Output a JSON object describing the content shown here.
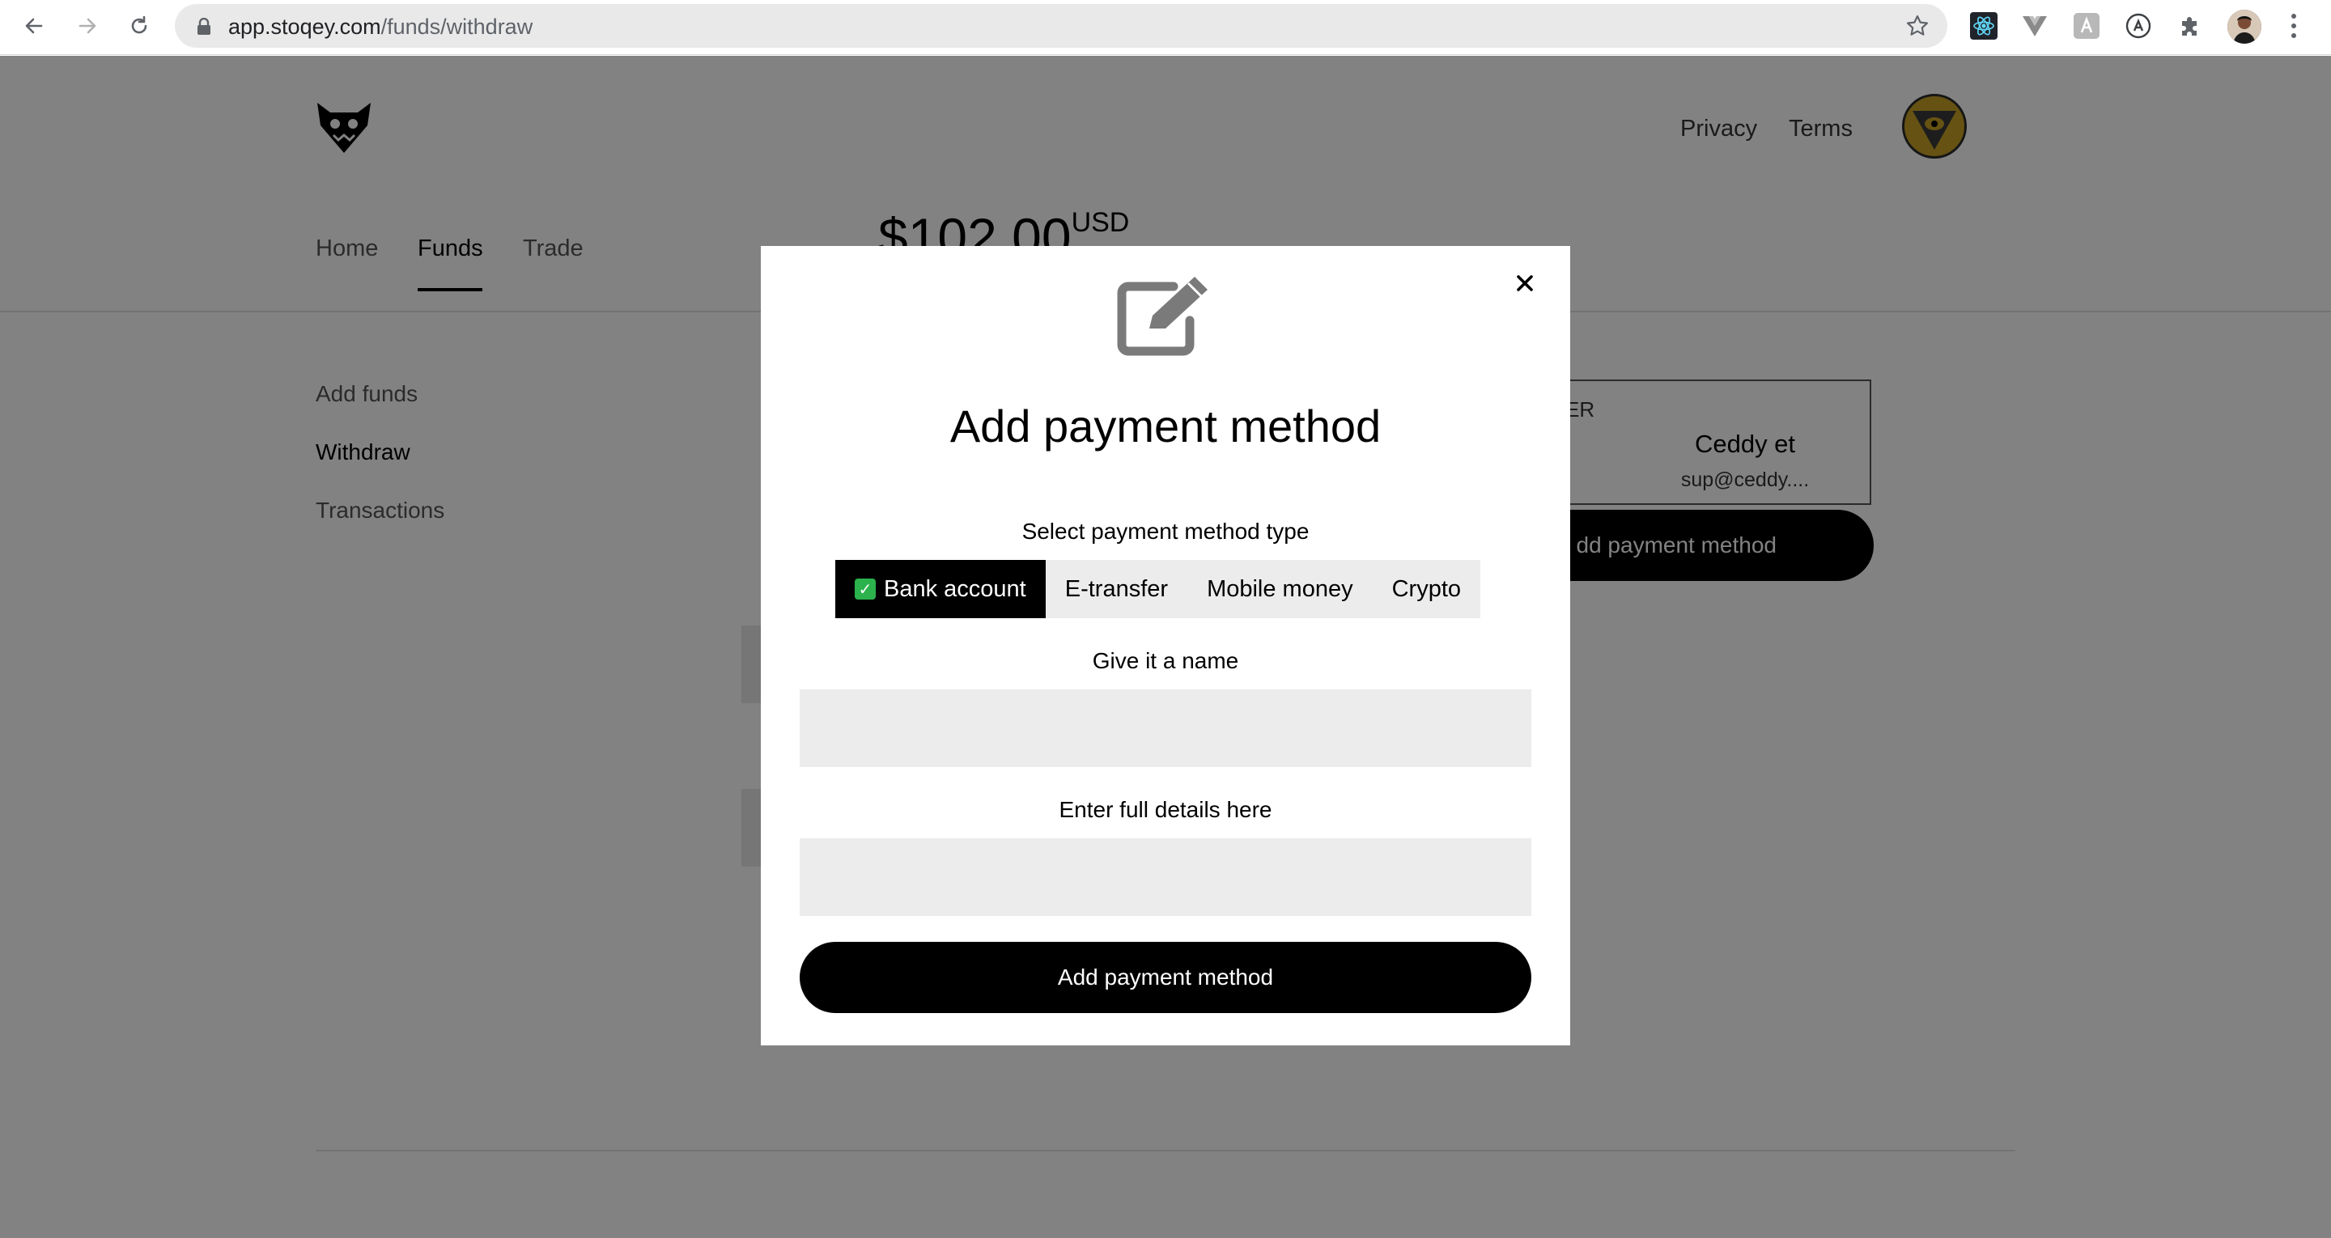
{
  "browser": {
    "url_host": "app.stoqey.com",
    "url_path": "/funds/withdraw",
    "icons": [
      "back-arrow-icon",
      "forward-arrow-icon",
      "reload-icon",
      "lock-icon",
      "bookmark-star-icon",
      "react-devtools-icon",
      "vue-devtools-icon",
      "extension-icon",
      "grammarly-icon",
      "puzzle-extensions-icon",
      "profile-avatar",
      "kebab-menu-icon"
    ]
  },
  "header": {
    "nav_links": [
      "Privacy",
      "Terms"
    ]
  },
  "tabs": [
    {
      "label": "Home",
      "active": false
    },
    {
      "label": "Funds",
      "active": true
    },
    {
      "label": "Trade",
      "active": false
    }
  ],
  "balance": {
    "amount": "$102.00",
    "currency": "USD"
  },
  "sidebar": {
    "items": [
      {
        "label": "Add funds",
        "active": false
      },
      {
        "label": "Withdraw",
        "active": true
      },
      {
        "label": "Transactions",
        "active": false
      }
    ]
  },
  "recipient": {
    "label_fragment": "ER",
    "name": "Ceddy et",
    "email": "sup@ceddy...."
  },
  "background_button": {
    "label": "dd payment method"
  },
  "modal": {
    "title": "Add payment method",
    "type_label": "Select payment method type",
    "types": [
      {
        "label": "Bank account",
        "selected": true
      },
      {
        "label": "E-transfer",
        "selected": false
      },
      {
        "label": "Mobile money",
        "selected": false
      },
      {
        "label": "Crypto",
        "selected": false
      }
    ],
    "name_label": "Give it a name",
    "name_value": "",
    "details_label": "Enter full details here",
    "details_value": "",
    "submit_label": "Add payment method",
    "icon": "edit-icon"
  },
  "colors": {
    "accent": "#000000",
    "check_green": "#2bb24c",
    "input_bg": "#ececec",
    "overlay": "rgba(0,0,0,0.49)"
  }
}
